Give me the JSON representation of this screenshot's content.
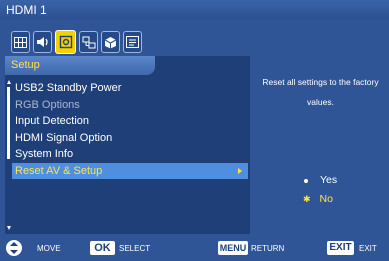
{
  "window": {
    "title": "HDMI 1"
  },
  "tabs": [
    {
      "icon": "picture-grid-icon",
      "active": false
    },
    {
      "icon": "speaker-icon",
      "active": false
    },
    {
      "icon": "gear-setup-icon",
      "active": true
    },
    {
      "icon": "network-icon",
      "active": false
    },
    {
      "icon": "cube-icon",
      "active": false
    },
    {
      "icon": "list-info-icon",
      "active": false
    }
  ],
  "section": {
    "title": "Setup"
  },
  "menu": {
    "items": [
      {
        "label": "USB2 Standby Power",
        "state": "normal"
      },
      {
        "label": "RGB Options",
        "state": "disabled"
      },
      {
        "label": "Input Detection",
        "state": "normal"
      },
      {
        "label": "HDMI Signal Option",
        "state": "normal"
      },
      {
        "label": "System Info",
        "state": "normal"
      },
      {
        "label": "Reset AV & Setup",
        "state": "selected"
      }
    ]
  },
  "detail": {
    "description": "Reset all settings to the factory values.",
    "options": [
      {
        "label": "Yes",
        "selected": false
      },
      {
        "label": "No",
        "selected": true
      }
    ]
  },
  "footer": {
    "move_label": "MOVE",
    "ok_key": "OK",
    "select_label": "SELECT",
    "menu_key": "MENU",
    "return_label": "RETURN",
    "exit_key": "EXIT",
    "exit_label": "EXIT"
  },
  "colors": {
    "background": "#2f5597",
    "panel": "#1f3f78",
    "highlight": "#4f8fe0",
    "accent_yellow": "#ffe34d"
  }
}
